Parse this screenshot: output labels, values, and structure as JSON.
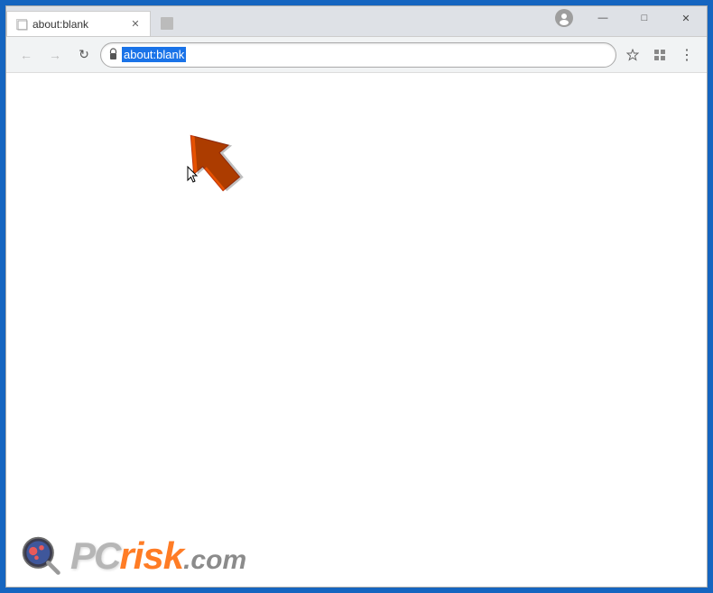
{
  "window": {
    "title": "about:blank",
    "controls": {
      "minimize": "—",
      "maximize": "□",
      "close": "✕"
    }
  },
  "tab": {
    "label": "about:blank",
    "close": "✕"
  },
  "toolbar": {
    "back_label": "←",
    "forward_label": "→",
    "refresh_label": "↻",
    "address": "about:blank",
    "bookmark_icon": "☆",
    "extensions_icon": "⧉",
    "menu_icon": "⋮",
    "profile_icon": "👤"
  },
  "content": {
    "background": "#ffffff"
  },
  "watermark": {
    "pc_text": "PC",
    "risk_text": "risk",
    "com_text": ".com"
  },
  "colors": {
    "accent": "#ff6600",
    "chrome_bg": "#dee1e6",
    "toolbar_bg": "#f1f3f4",
    "tab_active": "#ffffff",
    "address_selected": "#1a73e8",
    "outer_border": "#1565C0"
  }
}
